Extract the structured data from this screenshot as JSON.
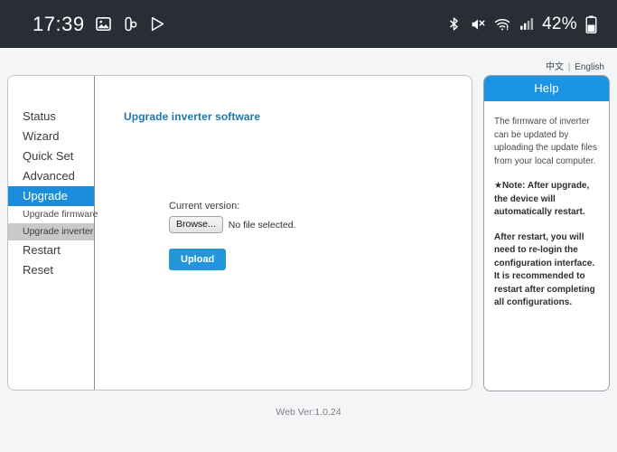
{
  "statusbar": {
    "clock": "17:39",
    "left_icons": [
      "photos-icon",
      "chrome-icon",
      "play-store-icon"
    ],
    "right_icons": [
      "bluetooth-icon",
      "volume-muted-icon",
      "wifi-warning-icon",
      "cellular-signal-icon"
    ],
    "battery_percent": "42%",
    "battery_icon": "battery-icon",
    "background_color": "#2b2d36"
  },
  "language": {
    "chinese": "中文",
    "separator": "|",
    "english": "English"
  },
  "sidebar": {
    "items": [
      {
        "label": "Status",
        "type": "main",
        "state": "normal"
      },
      {
        "label": "Wizard",
        "type": "main",
        "state": "normal"
      },
      {
        "label": "Quick Set",
        "type": "main",
        "state": "normal"
      },
      {
        "label": "Advanced",
        "type": "main",
        "state": "normal"
      },
      {
        "label": "Upgrade",
        "type": "main",
        "state": "active"
      },
      {
        "label": "Upgrade firmware",
        "type": "sub",
        "state": "normal"
      },
      {
        "label": "Upgrade inverter",
        "type": "sub",
        "state": "selected"
      },
      {
        "label": "Restart",
        "type": "main",
        "state": "normal"
      },
      {
        "label": "Reset",
        "type": "main",
        "state": "normal"
      }
    ]
  },
  "main": {
    "title": "Upgrade inverter software",
    "current_version_label": "Current version:",
    "browse_button": "Browse...",
    "file_status": "No file selected.",
    "upload_button": "Upload"
  },
  "help": {
    "header": "Help",
    "paragraphs": [
      {
        "text": "The firmware of inverter can be updated by uploading the update files from your local computer.",
        "bold": false
      },
      {
        "text": "★Note: After upgrade, the device will automatically restart.",
        "bold": true
      },
      {
        "text": "After restart, you will need to re-login the configuration interface. It is recommended to restart after completing all configurations.",
        "bold": true
      }
    ]
  },
  "footer": {
    "web_version": "Web Ver:1.0.24"
  },
  "colors": {
    "accent_blue": "#1b8ddd",
    "help_header_blue": "#1b94e4",
    "title_blue": "#1a78b4",
    "upload_blue": "#2196d9",
    "selected_gray": "#c9c9c9",
    "page_background": "#f4f5f7"
  }
}
